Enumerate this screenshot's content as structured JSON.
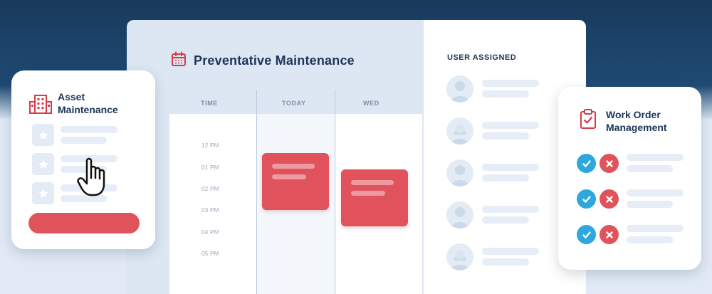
{
  "schedule": {
    "title": "Preventative Maintenance",
    "icon": "calendar-icon",
    "columns": [
      "TIME",
      "TODAY",
      "WED"
    ],
    "times": [
      "12 PM",
      "01 PM",
      "02 PM",
      "03 PM",
      "04 PM",
      "05 PM"
    ]
  },
  "users": {
    "title": "USER ASSIGNED"
  },
  "asset_card": {
    "title_line1": "Asset",
    "title_line2": "Maintenance",
    "icon": "building-icon"
  },
  "work_order_card": {
    "title_line1": "Work Order",
    "title_line2": "Management",
    "icon": "clipboard-check-icon"
  },
  "colors": {
    "navy": "#1c3559",
    "accent_red": "#e1535c",
    "accent_blue": "#2ea8dc",
    "skeleton": "#e6edf6"
  }
}
